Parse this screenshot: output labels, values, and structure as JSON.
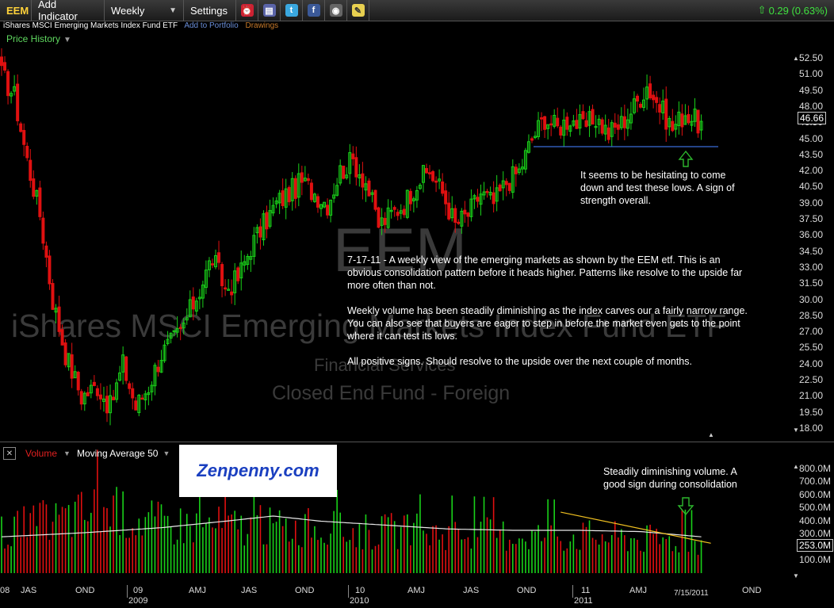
{
  "toolbar": {
    "ticker": "EEM",
    "add_indicator": "Add Indicator",
    "period": "Weekly",
    "settings": "Settings",
    "change": "0.29 (0.63%)",
    "icons": [
      "alarm-clock-icon",
      "book-icon",
      "twitter-icon",
      "facebook-icon",
      "camera-icon",
      "sticky-note-icon"
    ]
  },
  "subbar": {
    "fund_name": "iShares MSCI Emerging Markets Index Fund ETF",
    "add_to_portfolio": "Add to Portfolio",
    "drawings": "Drawings"
  },
  "panel": {
    "price_history": "Price History",
    "volume": "Volume",
    "moving_average": "Moving Average 50"
  },
  "watermark": {
    "ticker": "EEM",
    "name": "iShares MSCI Emerging Markets Index Fund ETF",
    "sector": "Financial Services",
    "category": "Closed End Fund - Foreign"
  },
  "annotations": {
    "hesitating": "It seems to be hesitating to come down and test these lows. A sign of strength overall.",
    "main_p1": "7-17-11 - A weekly view of the emerging markets as shown by the EEM etf. This is an obvious consolidation pattern before it heads higher. Patterns like resolve to the upside far more often than not.",
    "main_p2": "Weekly volume has been steadily diminishing as the index carves our a fairly narrow range. You can also see that buyers are eager to step in before the market even gets to the point where it can test its lows.",
    "main_p3": "All positive signs. Should resolve to the upside over the next couple of months.",
    "volume_note": "Steadily diminishing volume. A good sign during consolidation"
  },
  "logo": {
    "text": "Zenpenny.com"
  },
  "colors": {
    "up": "#19d119",
    "down": "#e01010",
    "ma": "#e8e8e8",
    "support": "#3a6bd8",
    "trend": "#f0c020",
    "arrow": "#2db82d",
    "logo_blue": "#1a3fc0",
    "logo_red": "#d21a1a"
  },
  "chart_data": [
    {
      "type": "candlestick",
      "ylim": [
        17.5,
        53.0
      ],
      "y_ticks": [
        "52.50",
        "51.00",
        "49.50",
        "48.00",
        "46.50",
        "45.00",
        "43.50",
        "42.00",
        "40.50",
        "39.00",
        "37.50",
        "36.00",
        "34.50",
        "33.00",
        "31.50",
        "30.00",
        "28.50",
        "27.00",
        "25.50",
        "24.00",
        "22.50",
        "21.00",
        "19.50",
        "18.00"
      ],
      "last_value": "46.66",
      "support_level": 44.3,
      "x_ticks": [
        "08",
        "JAS",
        "OND",
        "09",
        "AMJ",
        "JAS",
        "OND",
        "10",
        "AMJ",
        "JAS",
        "OND",
        "11",
        "AMJ",
        "7/15/2011",
        "OND"
      ],
      "x_years": [
        "2009",
        "2010",
        "2011"
      ],
      "close_anchors": [
        [
          0,
          51
        ],
        [
          4,
          49
        ],
        [
          8,
          43
        ],
        [
          12,
          38
        ],
        [
          16,
          30
        ],
        [
          20,
          25
        ],
        [
          25,
          21
        ],
        [
          30,
          22
        ],
        [
          34,
          20
        ],
        [
          38,
          24
        ],
        [
          42,
          20
        ],
        [
          46,
          22
        ],
        [
          50,
          25
        ],
        [
          56,
          27
        ],
        [
          62,
          31
        ],
        [
          66,
          34
        ],
        [
          70,
          31
        ],
        [
          74,
          32
        ],
        [
          78,
          35
        ],
        [
          82,
          37
        ],
        [
          86,
          39
        ],
        [
          90,
          40
        ],
        [
          94,
          41
        ],
        [
          98,
          40
        ],
        [
          102,
          39
        ],
        [
          106,
          42
        ],
        [
          110,
          43
        ],
        [
          114,
          41
        ],
        [
          118,
          37
        ],
        [
          122,
          38
        ],
        [
          126,
          39
        ],
        [
          130,
          41
        ],
        [
          134,
          42
        ],
        [
          138,
          40
        ],
        [
          142,
          37
        ],
        [
          146,
          38
        ],
        [
          150,
          40
        ],
        [
          154,
          39
        ],
        [
          158,
          41
        ],
        [
          162,
          42
        ],
        [
          166,
          45
        ],
        [
          170,
          47
        ],
        [
          174,
          46
        ],
        [
          178,
          47
        ],
        [
          182,
          46
        ],
        [
          186,
          47
        ],
        [
          190,
          45.5
        ],
        [
          194,
          46.5
        ],
        [
          198,
          48
        ],
        [
          202,
          50
        ],
        [
          206,
          48
        ],
        [
          210,
          46
        ],
        [
          214,
          47.5
        ],
        [
          218,
          46.5
        ],
        [
          219,
          46.66
        ]
      ],
      "n_weeks": 220
    },
    {
      "type": "bar",
      "series": "volume",
      "ylim": [
        0,
        900
      ],
      "y_ticks": [
        "800.0M",
        "700.0M",
        "600.0M",
        "500.0M",
        "400.0M",
        "300.0M",
        "200.0M",
        "100.0M"
      ],
      "last_value": "253.0M",
      "vol_anchors": [
        [
          0,
          330
        ],
        [
          20,
          430
        ],
        [
          30,
          500
        ],
        [
          50,
          390
        ],
        [
          70,
          370
        ],
        [
          90,
          360
        ],
        [
          110,
          330
        ],
        [
          130,
          320
        ],
        [
          150,
          310
        ],
        [
          170,
          300
        ],
        [
          190,
          290
        ],
        [
          200,
          270
        ],
        [
          219,
          253
        ]
      ],
      "ma_anchors": [
        [
          0,
          280
        ],
        [
          25,
          310
        ],
        [
          50,
          350
        ],
        [
          70,
          400
        ],
        [
          85,
          440
        ],
        [
          100,
          400
        ],
        [
          120,
          370
        ],
        [
          140,
          340
        ],
        [
          160,
          330
        ],
        [
          180,
          330
        ],
        [
          200,
          320
        ],
        [
          219,
          280
        ]
      ],
      "trend_from": [
        175,
        470
      ],
      "trend_to": [
        222,
        230
      ]
    }
  ]
}
